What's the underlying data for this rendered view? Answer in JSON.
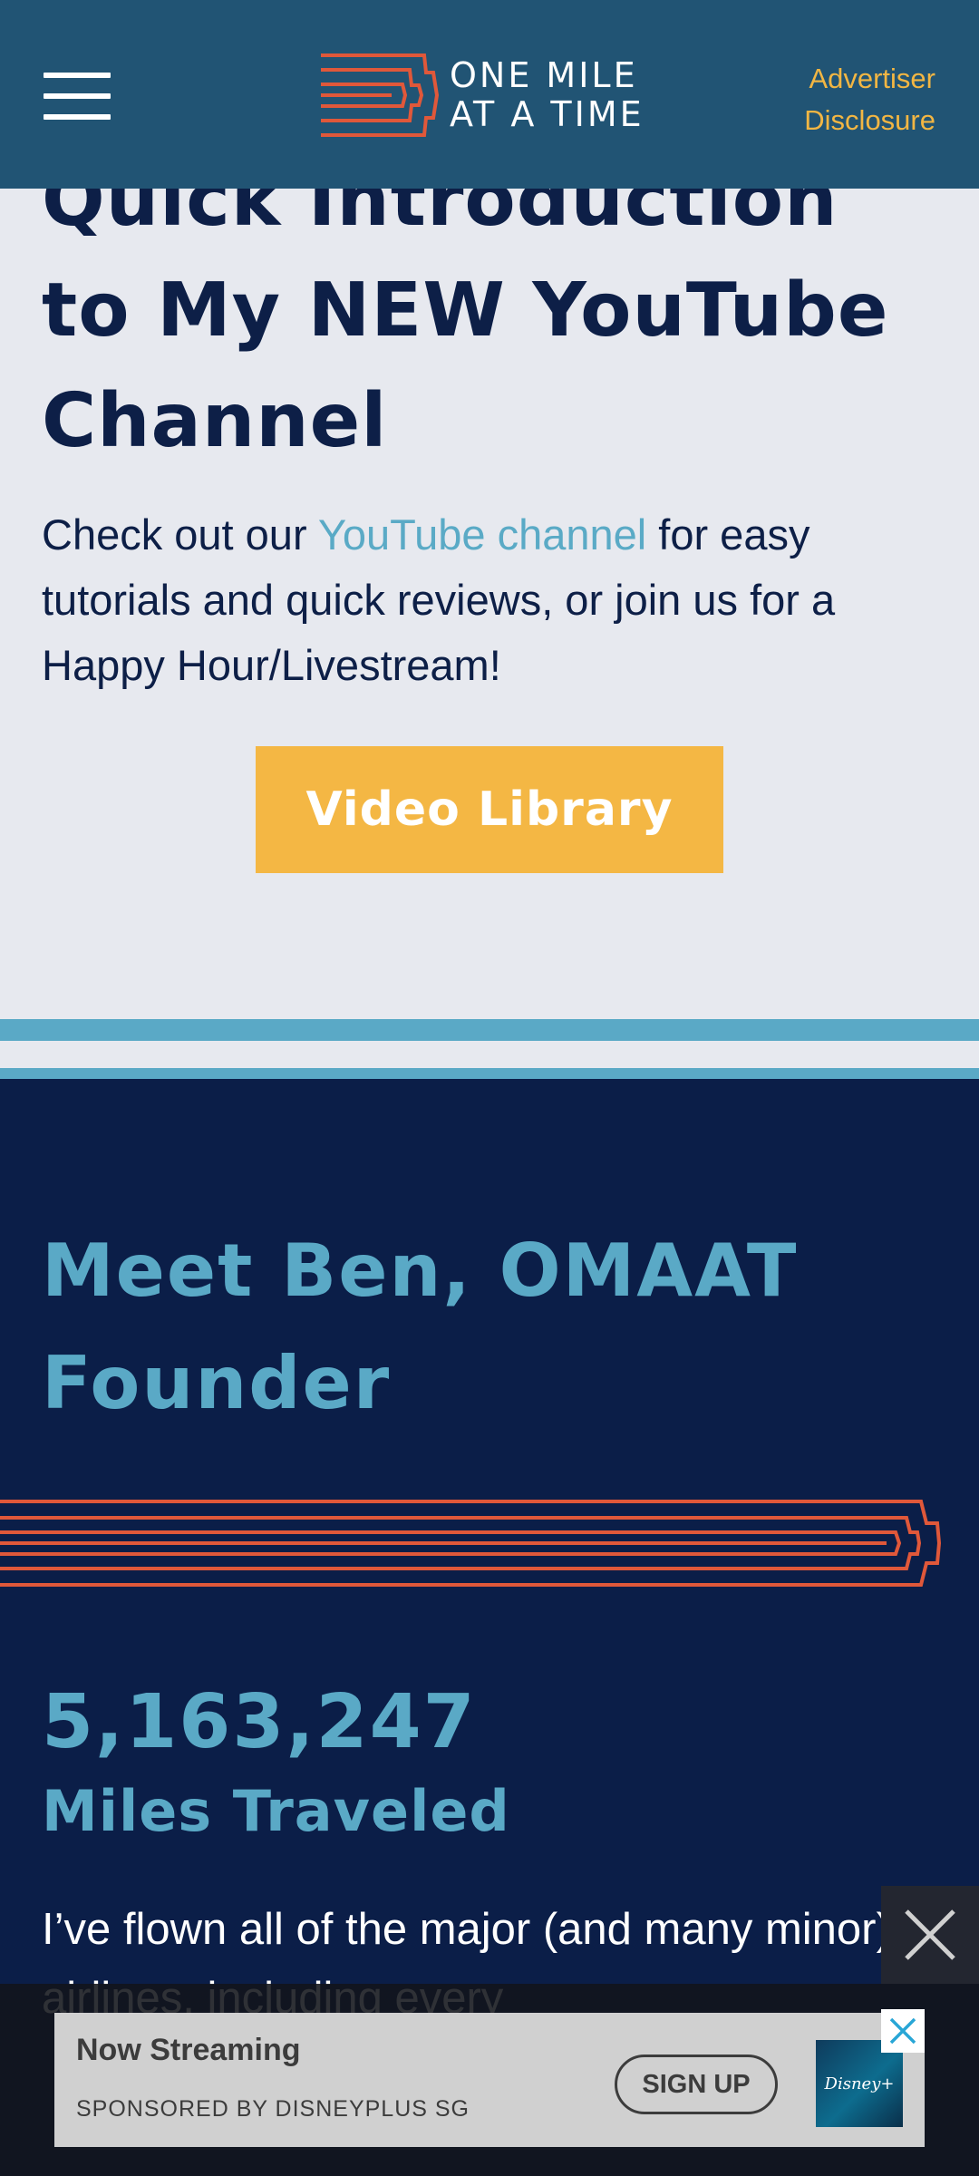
{
  "header": {
    "menu_label": "Menu",
    "logo_line1": "ONE MILE",
    "logo_line2": "AT A TIME",
    "disclosure_line1": "Advertiser",
    "disclosure_line2": "Disclosure"
  },
  "intro": {
    "title": "Quick Introduction to My NEW YouTube Channel",
    "text_before": "Check out our ",
    "link": "YouTube channel",
    "text_after": " for easy tutorials and quick reviews, or join us for a Happy Hour/Livestream!",
    "button": "Video Library"
  },
  "about": {
    "title": "Meet Ben, OMAAT Founder",
    "stat_number": "5,163,247",
    "stat_label": "Miles Traveled",
    "text": "I’ve flown all of the major (and many minor) airlines, including every"
  },
  "ad": {
    "title": "Now Streaming",
    "sponsor": "SPONSORED BY DISNEYPLUS SG",
    "cta": "SIGN UP",
    "brand": "Disney+"
  },
  "colors": {
    "header_bg": "#215474",
    "navy": "#0b1e48",
    "accent_blue": "#5aa9c6",
    "accent_orange": "#e0583a",
    "gold": "#f4b744"
  }
}
